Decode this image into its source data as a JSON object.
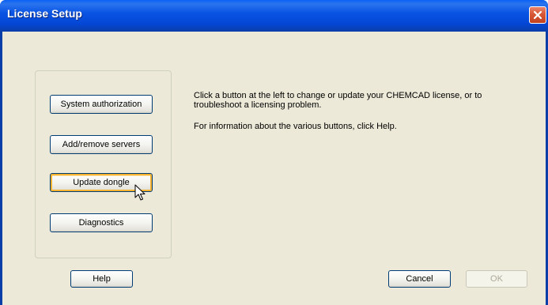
{
  "window": {
    "title": "License Setup",
    "close_icon": "close-x-icon"
  },
  "buttons": {
    "system_authorization": "System authorization",
    "add_remove_servers": "Add/remove servers",
    "update_dongle": "Update dongle",
    "diagnostics": "Diagnostics",
    "help": "Help",
    "cancel": "Cancel",
    "ok": "OK"
  },
  "message": {
    "line1": "Click a button at the left to change or update your CHEMCAD license, or to",
    "line2": "troubleshoot a licensing problem.",
    "line3": "For information about the various buttons, click Help."
  },
  "colors": {
    "titlebar_blue": "#0a55e3",
    "dialog_background": "#ece9d8",
    "close_red": "#d85836",
    "button_border": "#003c74",
    "hover_orange": "#f8b331"
  },
  "cursor_icon": "arrow-pointer-icon"
}
